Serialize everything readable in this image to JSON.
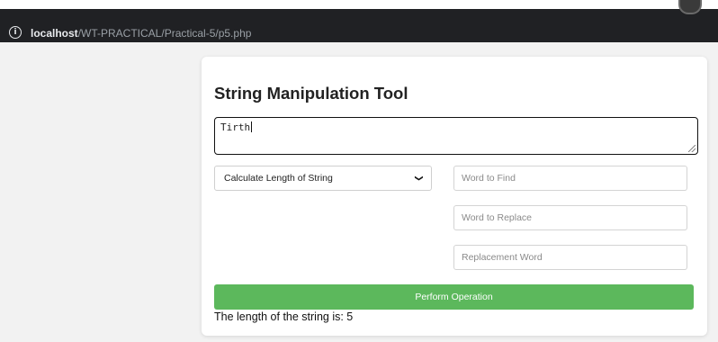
{
  "browser": {
    "url_host": "localhost",
    "url_path": "/WT-PRACTICAL/Practical-5/p5.php"
  },
  "tool": {
    "title": "String Manipulation Tool",
    "input_text": "Tirth",
    "operation": {
      "selected": "Calculate Length of String"
    },
    "fields": {
      "find_placeholder": "Word to Find",
      "replace_placeholder": "Word to Replace",
      "replacement_placeholder": "Replacement Word"
    },
    "button_label": "Perform Operation",
    "result": "The length of the string is: 5"
  },
  "colors": {
    "button": "#5cb85c",
    "address_bar": "#202124"
  }
}
